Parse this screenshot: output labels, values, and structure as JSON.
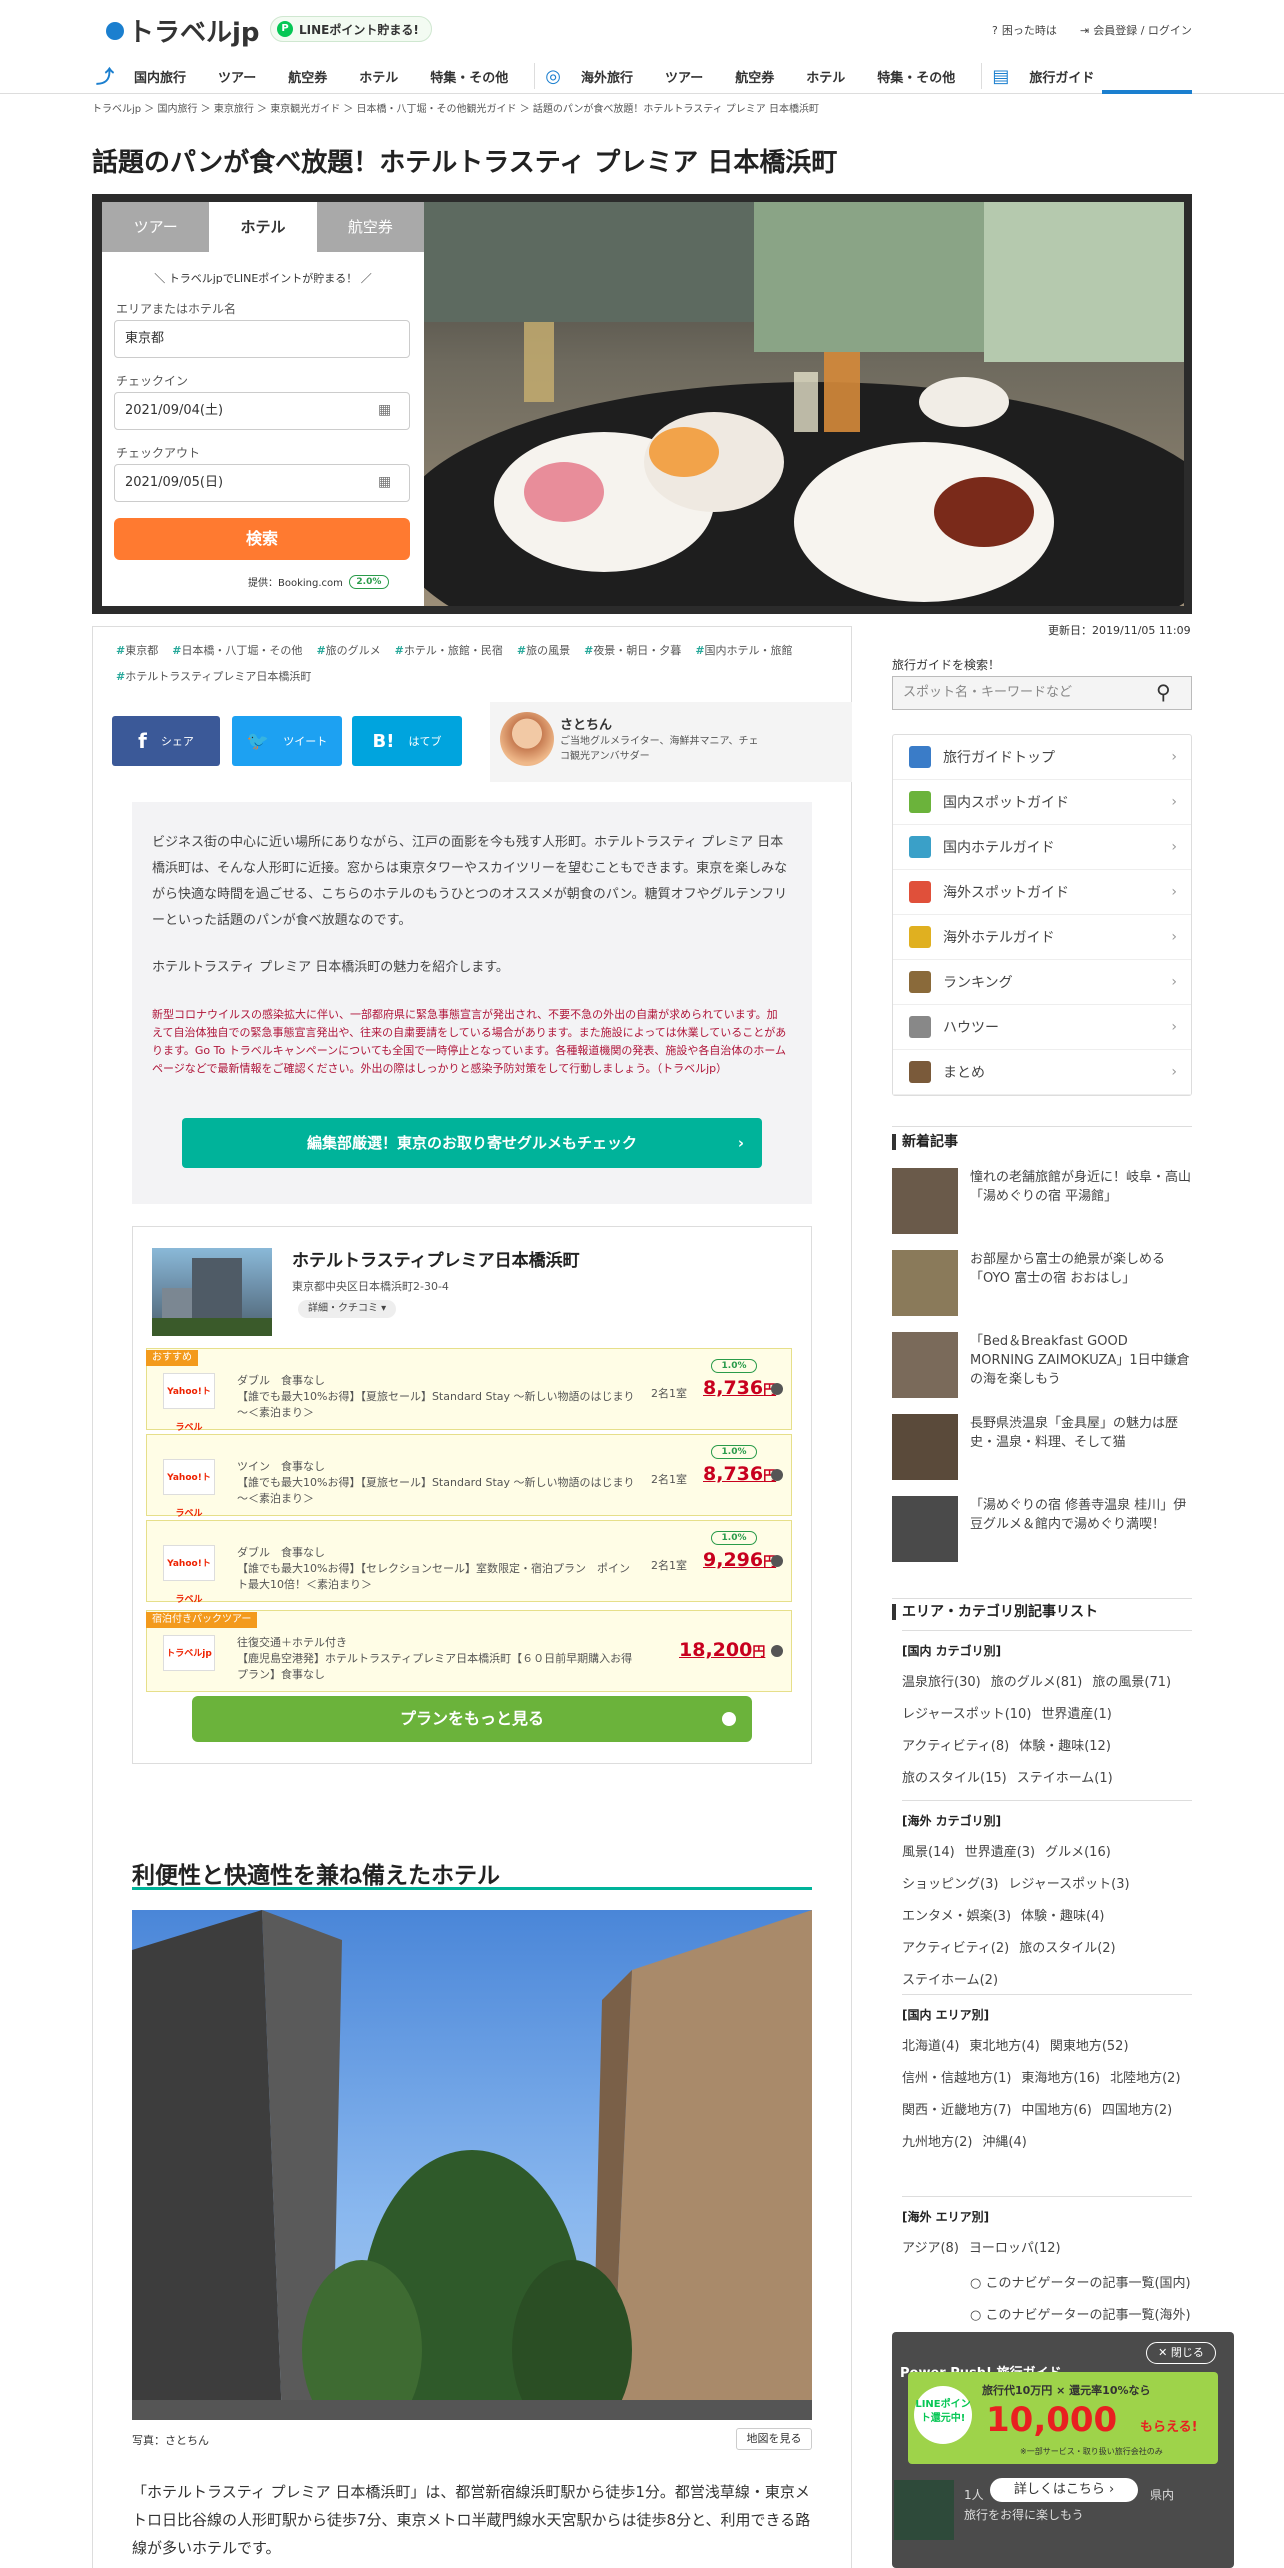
{
  "header": {
    "logo": "トラベルjp",
    "line_badge": "LINEポイント貯まる!",
    "help_link": "困った時は",
    "login_link": "会員登録 / ログイン",
    "nav": [
      "国内旅行",
      "ツアー",
      "航空券",
      "ホテル",
      "特集・その他",
      "海外旅行",
      "ツアー",
      "航空券",
      "ホテル",
      "特集・その他",
      "旅行ガイド"
    ]
  },
  "breadcrumb": "トラベルjp ＞ 国内旅行 ＞ 東京旅行 ＞ 東京観光ガイド ＞ 日本橋・八丁堀・その他観光ガイド ＞ 話題のパンが食べ放題！ホテルトラスティ プレミア 日本橋浜町",
  "page_title": "話題のパンが食べ放題！ホテルトラスティ プレミア 日本橋浜町",
  "search_box": {
    "tabs": [
      "ツアー",
      "ホテル",
      "航空券"
    ],
    "active_tab": "ホテル",
    "promo": "＼ トラベルjpでLINEポイントが貯まる！ ／",
    "area_label": "エリアまたはホテル名",
    "area_value": "東京都",
    "checkin_label": "チェックイン",
    "checkin_value": "2021/09/04(土)",
    "checkout_label": "チェックアウト",
    "checkout_value": "2021/09/05(日)",
    "search_button": "検索",
    "provider": "提供：Booking.com",
    "provider_rate": "2.0%"
  },
  "updated": "更新日：2019/11/05 11:09",
  "tags": [
    "東京都",
    "日本橋・八丁堀・その他",
    "旅のグルメ",
    "ホテル・旅館・民宿",
    "旅の風景",
    "夜景・朝日・夕暮",
    "国内ホテル・旅館",
    "ホテルトラスティプレミア日本橋浜町"
  ],
  "share": {
    "facebook": "シェア",
    "twitter": "ツイート",
    "hatena": "はてブ"
  },
  "author": {
    "name": "さとちん",
    "desc": "ご当地グルメライター、海鮮丼マニア、チェコ観光アンバサダー"
  },
  "intro": {
    "p1": "ビジネス街の中心に近い場所にありながら、江戸の面影を今も残す人形町。ホテルトラスティ プレミア 日本橋浜町は、そんな人形町に近接。窓からは東京タワーやスカイツリーを望むこともできます。東京を楽しみながら快適な時間を過ごせる、こちらのホテルのもうひとつのオススメが朝食のパン。糖質オフやグルテンフリーといった話題のパンが食べ放題なのです。",
    "p2": "ホテルトラスティ プレミア 日本橋浜町の魅力を紹介します。",
    "notice": "新型コロナウイルスの感染拡大に伴い、一部都府県に緊急事態宣言が発出され、不要不急の外出の自粛が求められています。加えて自治体独自での緊急事態宣言発出や、往来の自粛要請をしている場合があります。また施設によっては休業していることがあります。Go To トラベルキャンペーンについても全国で一時停止となっています。各種報道機関の発表、施設や各自治体のホームページなどで最新情報をご確認ください。外出の際はしっかりと感染予防対策をして行動しましょう。（トラベルjp）",
    "cta": "編集部厳選！東京のお取り寄せグルメもチェック"
  },
  "hotel": {
    "name": "ホテルトラスティプレミア日本橋浜町",
    "address": "東京都中央区日本橋浜町2-30-4",
    "detail_link": "詳細・クチコミ ▾",
    "recommend_label": "おすすめ",
    "package_label": "宿泊付きパックツアー",
    "plans": [
      {
        "provider": "Yahoo!トラベル",
        "room": "ダブル　食事なし",
        "desc": "【誰でも最大10%お得】【夏旅セール】Standard Stay ～新しい物語のはじまり～＜素泊まり＞",
        "per": "2名1室",
        "price": "8,736",
        "rate": "1.0%"
      },
      {
        "provider": "Yahoo!トラベル",
        "room": "ツイン　食事なし",
        "desc": "【誰でも最大10%お得】【夏旅セール】Standard Stay ～新しい物語のはじまり～＜素泊まり＞",
        "per": "2名1室",
        "price": "8,736",
        "rate": "1.0%"
      },
      {
        "provider": "Yahoo!トラベル",
        "room": "ダブル　食事なし",
        "desc": "【誰でも最大10%お得】【セレクションセール】室数限定・宿泊プラン　ポイント最大10倍！＜素泊まり＞",
        "per": "2名1室",
        "price": "9,296",
        "rate": "1.0%"
      },
      {
        "provider": "トラベルjp",
        "room": "往復交通＋ホテル付き",
        "desc": "【鹿児島空港発】ホテルトラスティプレミア日本橋浜町【６０日前早期購入お得プラン】食事なし",
        "per": "",
        "price": "18,200",
        "rate": ""
      }
    ],
    "yen": "円",
    "more_plans": "プランをもっと見る"
  },
  "section2": {
    "heading": "利便性と快適性を兼ね備えたホテル",
    "caption": "写真：さとちん",
    "map_button": "地図を見る",
    "body": "「ホテルトラスティ プレミア 日本橋浜町」は、都営新宿線浜町駅から徒歩1分。都営浅草線・東京メトロ日比谷線の人形町駅から徒歩7分、東京メトロ半蔵門線水天宮駅からは徒歩8分と、利用できる路線が多いホテルです。"
  },
  "sidebar": {
    "search_label": "旅行ガイドを検索！",
    "search_placeholder": "スポット名・キーワードなど",
    "menu": [
      "旅行ガイドトップ",
      "国内スポットガイド",
      "国内ホテルガイド",
      "海外スポットガイド",
      "海外ホテルガイド",
      "ランキング",
      "ハウツー",
      "まとめ"
    ],
    "menu_colors": [
      "#3a7cc8",
      "#6bb33b",
      "#3aa0c8",
      "#e0503a",
      "#e0b020",
      "#8a6a3a",
      "#888888",
      "#7a5a3a"
    ],
    "news_heading": "新着記事",
    "news": [
      "憧れの老舗旅館が身近に！岐阜・高山「湯めぐりの宿 平湯館」",
      "お部屋から富士の絶景が楽しめる「OYO 富士の宿 おおはし」",
      "「Bed＆Breakfast GOOD MORNING ZAIMOKUZA」1日中鎌倉の海を楽しもう",
      "長野県渋温泉「金具屋」の魅力は歴史・温泉・料理、そして猫",
      "「湯めぐりの宿 修善寺温泉 桂川」伊豆グルメ＆館内で湯めぐり満喫！"
    ],
    "cat_heading": "エリア・カテゴリ別記事リスト",
    "cats": [
      {
        "title": "[国内 カテゴリ別]",
        "items": [
          "温泉旅行(30)",
          "旅のグルメ(81)",
          "旅の風景(71)",
          "レジャースポット(10)",
          "世界遺産(1)",
          "アクティビティ(8)",
          "体験・趣味(12)",
          "旅のスタイル(15)",
          "ステイホーム(1)"
        ]
      },
      {
        "title": "[海外 カテゴリ別]",
        "items": [
          "風景(14)",
          "世界遺産(3)",
          "グルメ(16)",
          "ショッピング(3)",
          "レジャースポット(3)",
          "エンタメ・娯楽(3)",
          "体験・趣味(4)",
          "アクティビティ(2)",
          "旅のスタイル(2)",
          "ステイホーム(2)"
        ]
      },
      {
        "title": "[国内 エリア別]",
        "items": [
          "北海道(4)",
          "東北地方(4)",
          "関東地方(52)",
          "信州・信越地方(1)",
          "東海地方(16)",
          "北陸地方(2)",
          "関西・近畿地方(7)",
          "中国地方(6)",
          "四国地方(2)",
          "九州地方(2)",
          "沖縄(4)"
        ]
      },
      {
        "title": "[海外 エリア別]",
        "items": [
          "アジア(8)",
          "ヨーロッパ(12)"
        ]
      }
    ],
    "navi_domestic": "このナビゲーターの記事一覧(国内)",
    "navi_overseas": "このナビゲーターの記事一覧(海外)"
  },
  "popup": {
    "close": "閉じる",
    "title": "Power Push! 旅行ガイド",
    "line_badge": "LINEポイント還元中!",
    "banner_text1": "旅行代10万円 × 還元率10%なら",
    "banner_big": "10,000",
    "banner_suffix": "もらえる!",
    "banner_note": "※一部サービス・取り扱い旅行会社のみ",
    "detail": "詳しくはこちら",
    "peek_text": "1人",
    "peek_text2": "県内",
    "peek_text3": "旅行をお得に楽しもう"
  }
}
